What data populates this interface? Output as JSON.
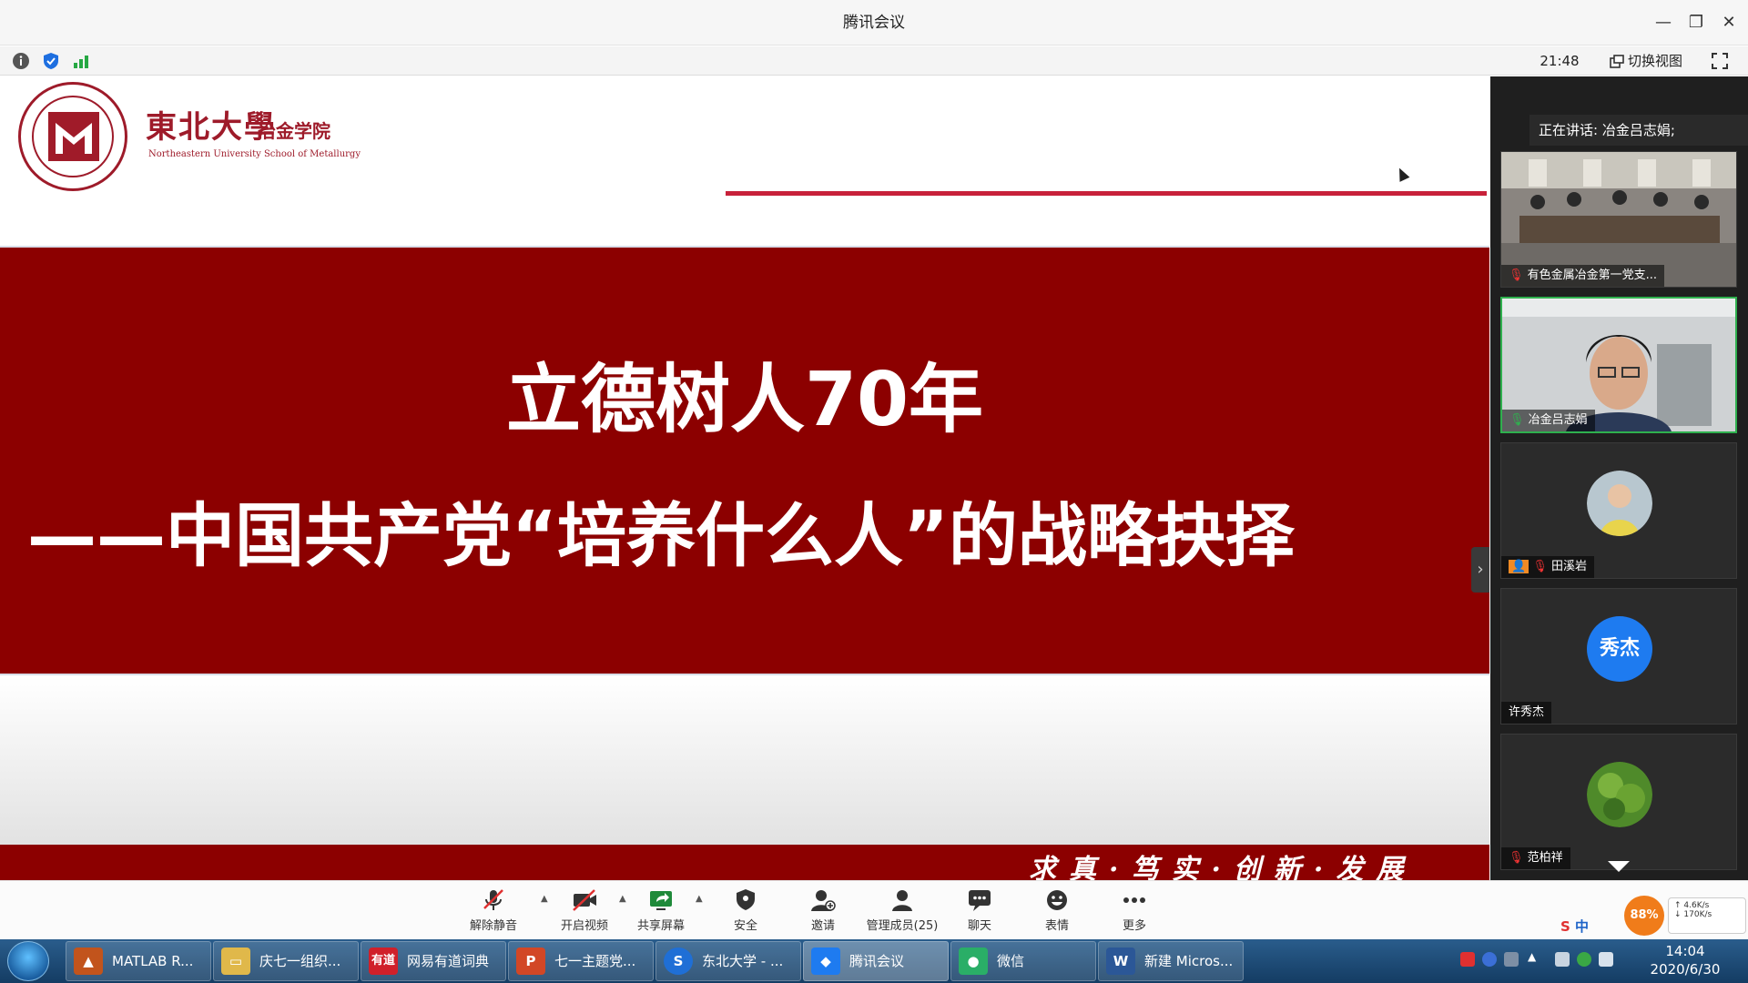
{
  "window": {
    "title": "腾讯会议"
  },
  "topbar": {
    "time": "21:48",
    "switch_view": "切换视图"
  },
  "slide": {
    "school_name_cn": "東北大學",
    "school_name_cn2": "冶金学院",
    "school_name_en": "Northeastern University School of Metallurgy",
    "title": "立德树人70年",
    "subtitle": "——中国共产党“培养什么人”的战略抉择",
    "motto": "求真·笃实·创新·发展"
  },
  "panel": {
    "speaking": "正在讲话: 冶金吕志娟;",
    "participants": [
      {
        "name": "有色金属冶金第一党支...",
        "type": "video"
      },
      {
        "name": "冶金吕志娟",
        "type": "video",
        "active": true
      },
      {
        "name": "田溪岩",
        "type": "avatar"
      },
      {
        "name": "许秀杰",
        "type": "text-avatar",
        "avatar_text": "秀杰"
      },
      {
        "name": "范柏祥",
        "type": "avatar"
      }
    ]
  },
  "toolbar": {
    "unmute": "解除静音",
    "start_video": "开启视频",
    "share_screen": "共享屏幕",
    "security": "安全",
    "invite": "邀请",
    "manage_members": "管理成员(25)",
    "chat": "聊天",
    "emoji": "表情",
    "more": "更多",
    "battery": "88%",
    "net_up": "4.6K/s",
    "net_down": "170K/s",
    "ime": "中"
  },
  "taskbar": {
    "tasks": [
      {
        "label": "MATLAB R..."
      },
      {
        "label": "庆七一组织..."
      },
      {
        "label": "网易有道词典",
        "icon_text": "有道"
      },
      {
        "label": "七一主题党..."
      },
      {
        "label": "东北大学 - ..."
      },
      {
        "label": "腾讯会议",
        "active": true
      },
      {
        "label": "微信"
      },
      {
        "label": "新建 Micros..."
      }
    ],
    "clock_time": "14:04",
    "clock_date": "2020/6/30"
  },
  "colors": {
    "slide_red": "#8c0000",
    "accent_line": "#c8213a",
    "active_tile": "#2fb04e",
    "avatar_blue": "#1e7bf0"
  }
}
